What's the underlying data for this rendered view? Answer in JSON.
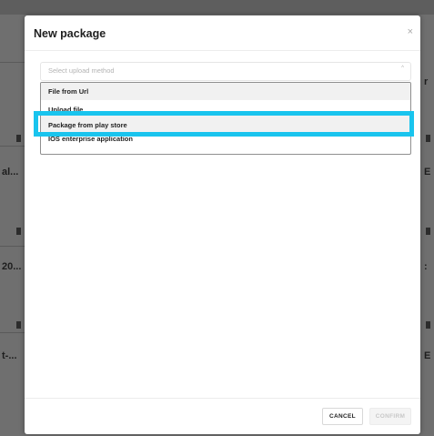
{
  "modal": {
    "title": "New package",
    "close_label": "×"
  },
  "select": {
    "placeholder": "Select upload method",
    "chevron": "^"
  },
  "options": [
    {
      "label": "File from Url"
    },
    {
      "label": "Upload file"
    },
    {
      "label": "Package from play store"
    },
    {
      "label": "IOS enterprise application"
    }
  ],
  "footer": {
    "cancel_label": "CANCEL",
    "confirm_label": "CONFIRM"
  },
  "background": {
    "left_snippets": [
      "al...",
      "20...",
      "t-..."
    ],
    "right_snippets": [
      "r",
      "E",
      ":",
      "E"
    ]
  },
  "colors": {
    "highlight": "#19c4ee",
    "overlay": "#6f6f6f"
  },
  "icons": {
    "close": "close-icon",
    "chevron": "chevron-up-icon"
  }
}
